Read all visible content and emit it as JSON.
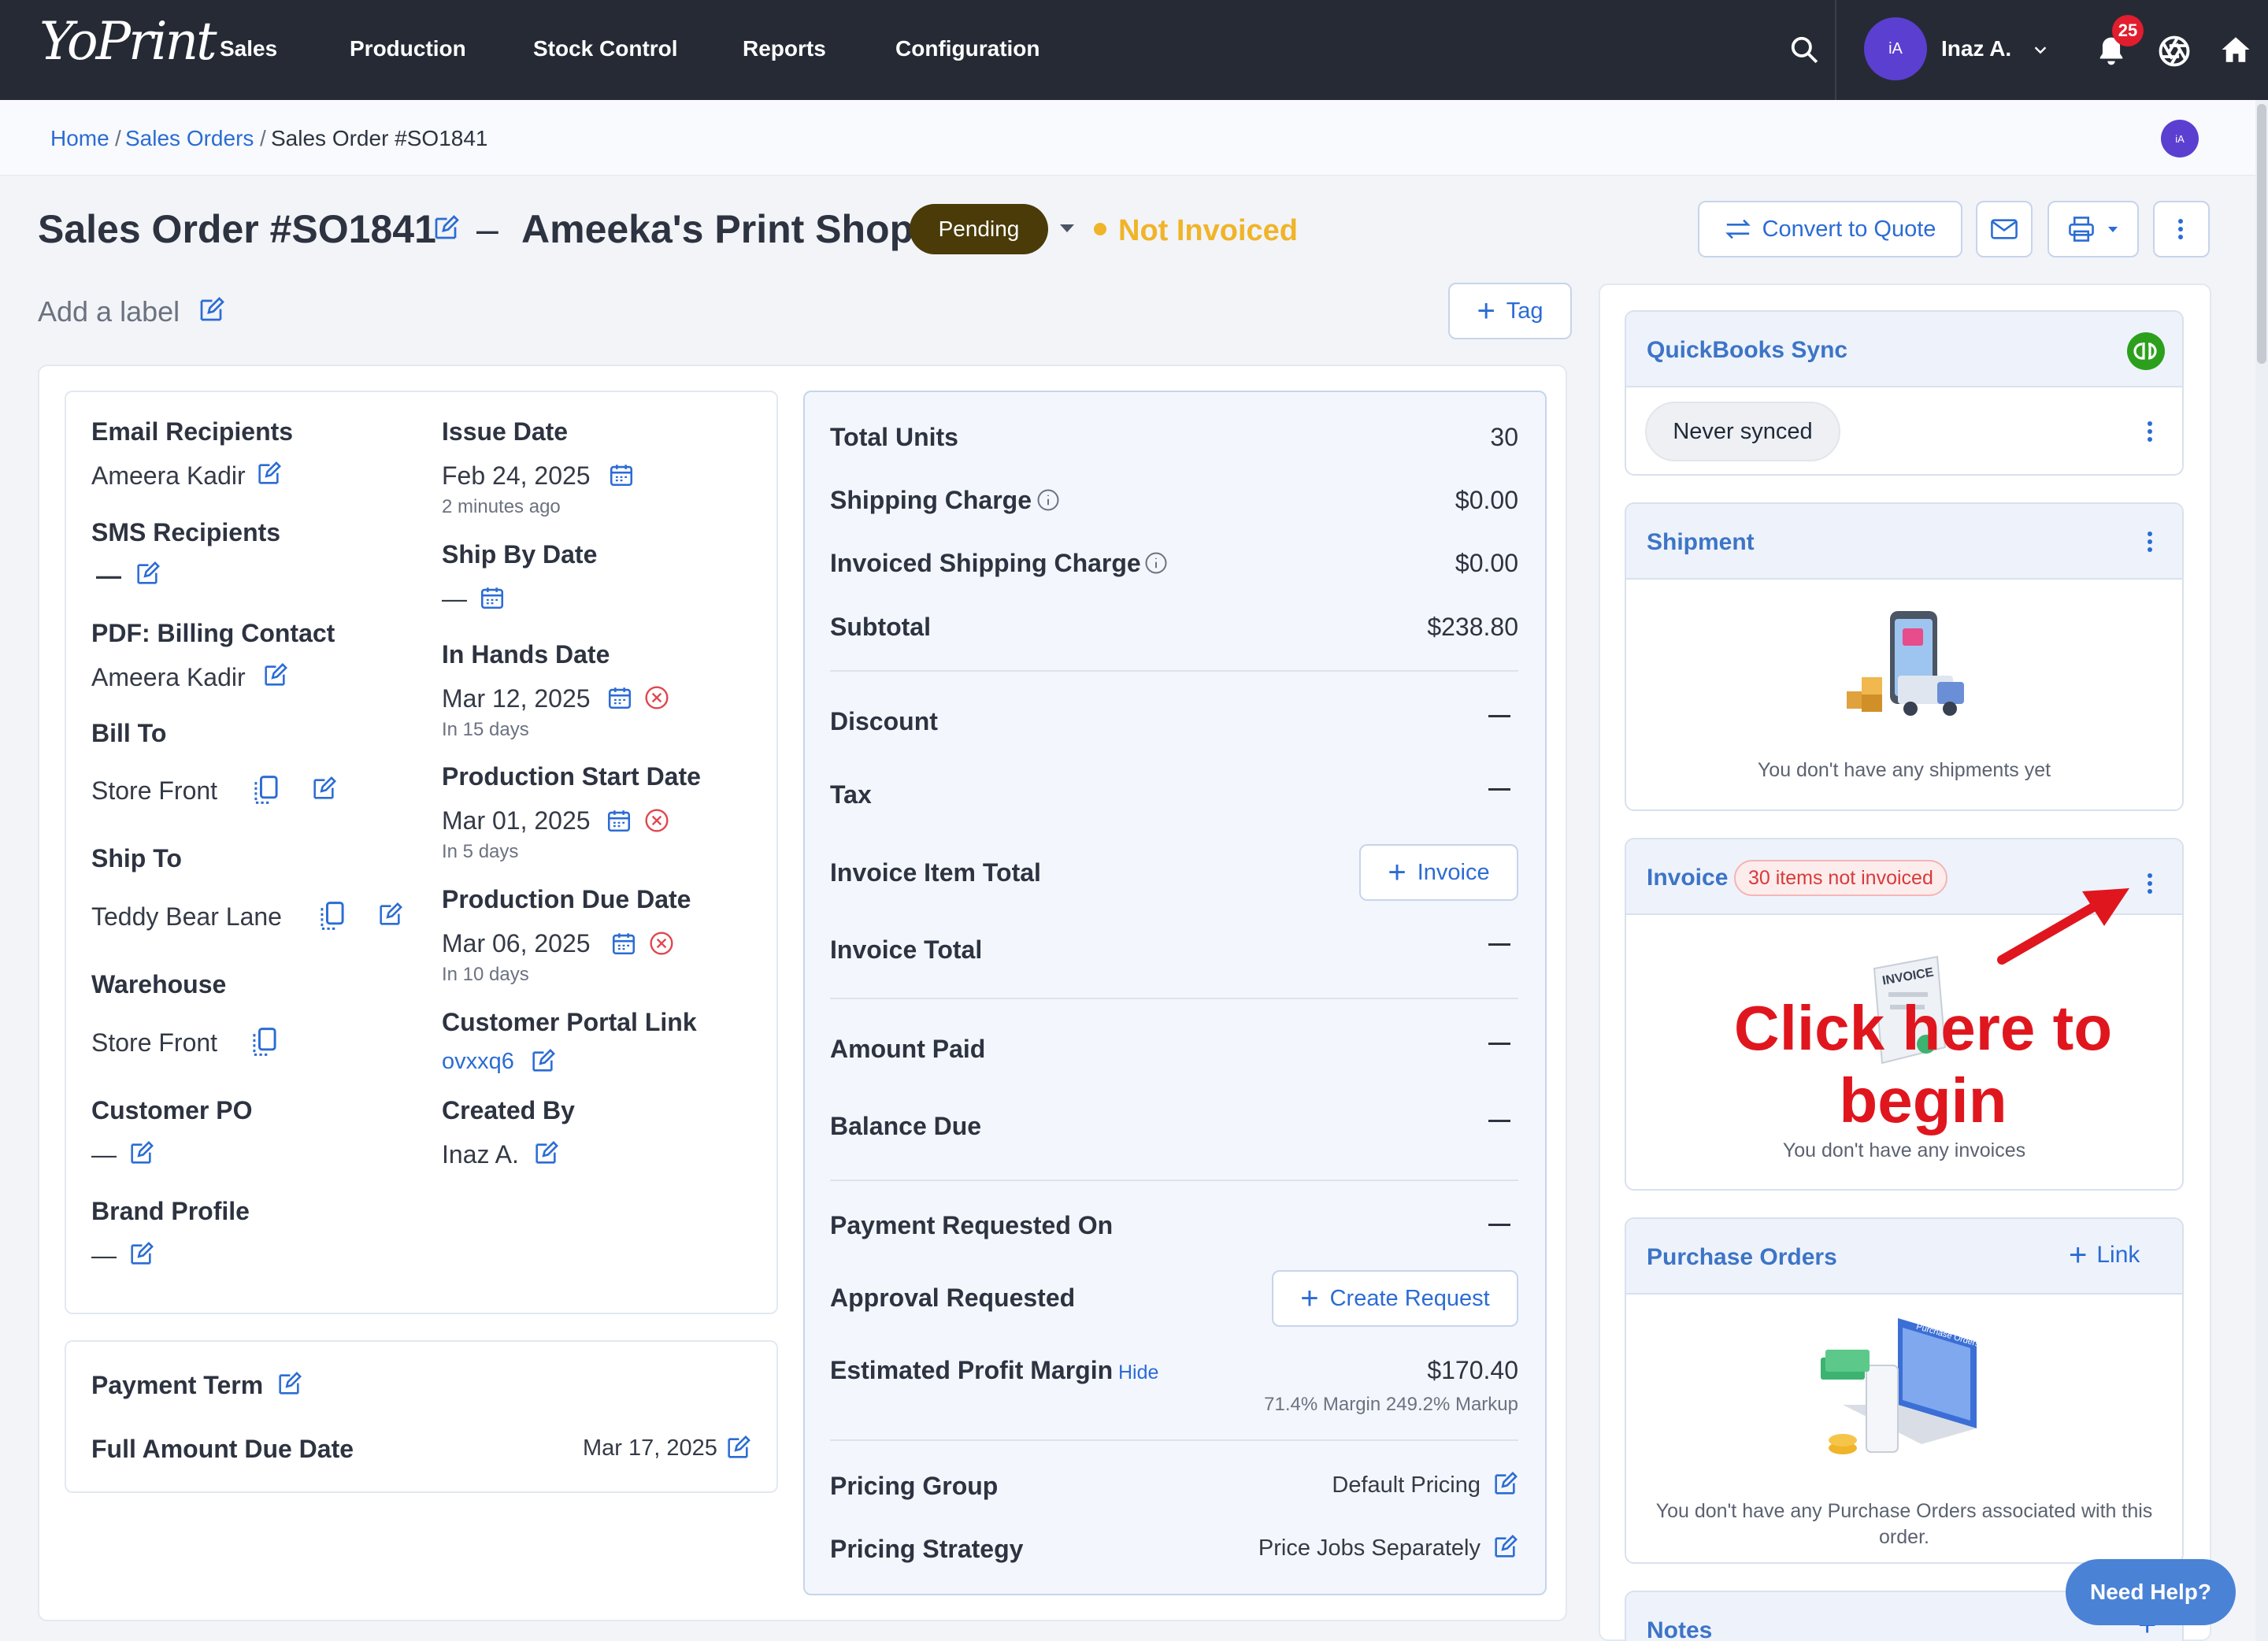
{
  "nav": {
    "logo": "YoPrint",
    "items": [
      "Sales",
      "Production",
      "Stock Control",
      "Reports",
      "Configuration"
    ],
    "user_initials": "iA",
    "user_name": "Inaz A.",
    "notification_count": "25"
  },
  "breadcrumb": {
    "home": "Home",
    "sales_orders": "Sales Orders",
    "current": "Sales Order #SO1841",
    "sep": "/",
    "avatar_initials": "iA"
  },
  "header": {
    "title": "Sales Order #SO1841",
    "dash": "–",
    "customer": "Ameeka's Print Shop",
    "status": "Pending",
    "invoice_status": "Not Invoiced",
    "add_label": "Add a label",
    "tag_button": "Tag",
    "convert_button": "Convert to Quote"
  },
  "details_left": {
    "email_recipients_label": "Email Recipients",
    "email_recipients_value": "Ameera Kadir",
    "sms_recipients_label": "SMS Recipients",
    "sms_recipients_value": "—",
    "pdf_billing_label": "PDF: Billing Contact",
    "pdf_billing_value": "Ameera Kadir",
    "bill_to_label": "Bill To",
    "bill_to_value": "Store Front",
    "ship_to_label": "Ship To",
    "ship_to_value": "Teddy Bear Lane",
    "warehouse_label": "Warehouse",
    "warehouse_value": "Store Front",
    "customer_po_label": "Customer PO",
    "customer_po_value": "—",
    "brand_profile_label": "Brand Profile",
    "brand_profile_value": "—"
  },
  "details_right": {
    "issue_date_label": "Issue Date",
    "issue_date_value": "Feb 24, 2025",
    "issue_date_sub": "2 minutes ago",
    "ship_by_label": "Ship By Date",
    "ship_by_value": "—",
    "in_hands_label": "In Hands Date",
    "in_hands_value": "Mar 12, 2025",
    "in_hands_sub": "In 15 days",
    "prod_start_label": "Production Start Date",
    "prod_start_value": "Mar 01, 2025",
    "prod_start_sub": "In 5 days",
    "prod_due_label": "Production Due Date",
    "prod_due_value": "Mar 06, 2025",
    "prod_due_sub": "In 10 days",
    "portal_label": "Customer Portal Link",
    "portal_value": "ovxxq6",
    "created_by_label": "Created By",
    "created_by_value": "Inaz A."
  },
  "payment": {
    "term_label": "Payment Term",
    "due_label": "Full Amount Due Date",
    "due_value": "Mar 17, 2025"
  },
  "totals": {
    "total_units_label": "Total Units",
    "total_units_value": "30",
    "shipping_label": "Shipping Charge",
    "shipping_value": "$0.00",
    "inv_shipping_label": "Invoiced Shipping Charge",
    "inv_shipping_value": "$0.00",
    "subtotal_label": "Subtotal",
    "subtotal_value": "$238.80",
    "discount_label": "Discount",
    "tax_label": "Tax",
    "invoice_item_total_label": "Invoice Item Total",
    "invoice_button": "Invoice",
    "invoice_total_label": "Invoice Total",
    "amount_paid_label": "Amount Paid",
    "balance_due_label": "Balance Due",
    "payment_requested_label": "Payment Requested On",
    "approval_label": "Approval Requested",
    "create_request_button": "Create Request",
    "profit_label": "Estimated Profit Margin",
    "profit_hide": "Hide",
    "profit_value": "$170.40",
    "profit_sub": "71.4% Margin 249.2% Markup",
    "pricing_group_label": "Pricing Group",
    "pricing_group_value": "Default Pricing",
    "pricing_strategy_label": "Pricing Strategy",
    "pricing_strategy_value": "Price Jobs Separately"
  },
  "sidebar": {
    "qb_title": "QuickBooks Sync",
    "qb_status": "Never synced",
    "shipment_title": "Shipment",
    "shipment_empty": "You don't have any shipments yet",
    "invoice_title": "Invoice",
    "invoice_badge": "30 items not invoiced",
    "invoice_empty": "You don't have any invoices",
    "invoice_art_text": "INVOICE",
    "po_title": "Purchase Orders",
    "po_link": "Link",
    "po_art_text": "Purchase Orders",
    "po_empty": "You don't have any Purchase Orders associated with this order.",
    "notes_title": "Notes"
  },
  "annotation": {
    "text": "Click here to begin",
    "color": "#e0161e"
  },
  "help_button": "Need Help?",
  "colors": {
    "accent": "#2b6cd4",
    "nav_bg": "#262a35",
    "pending": "#4a3b08",
    "not_invoiced": "#f0b429"
  }
}
